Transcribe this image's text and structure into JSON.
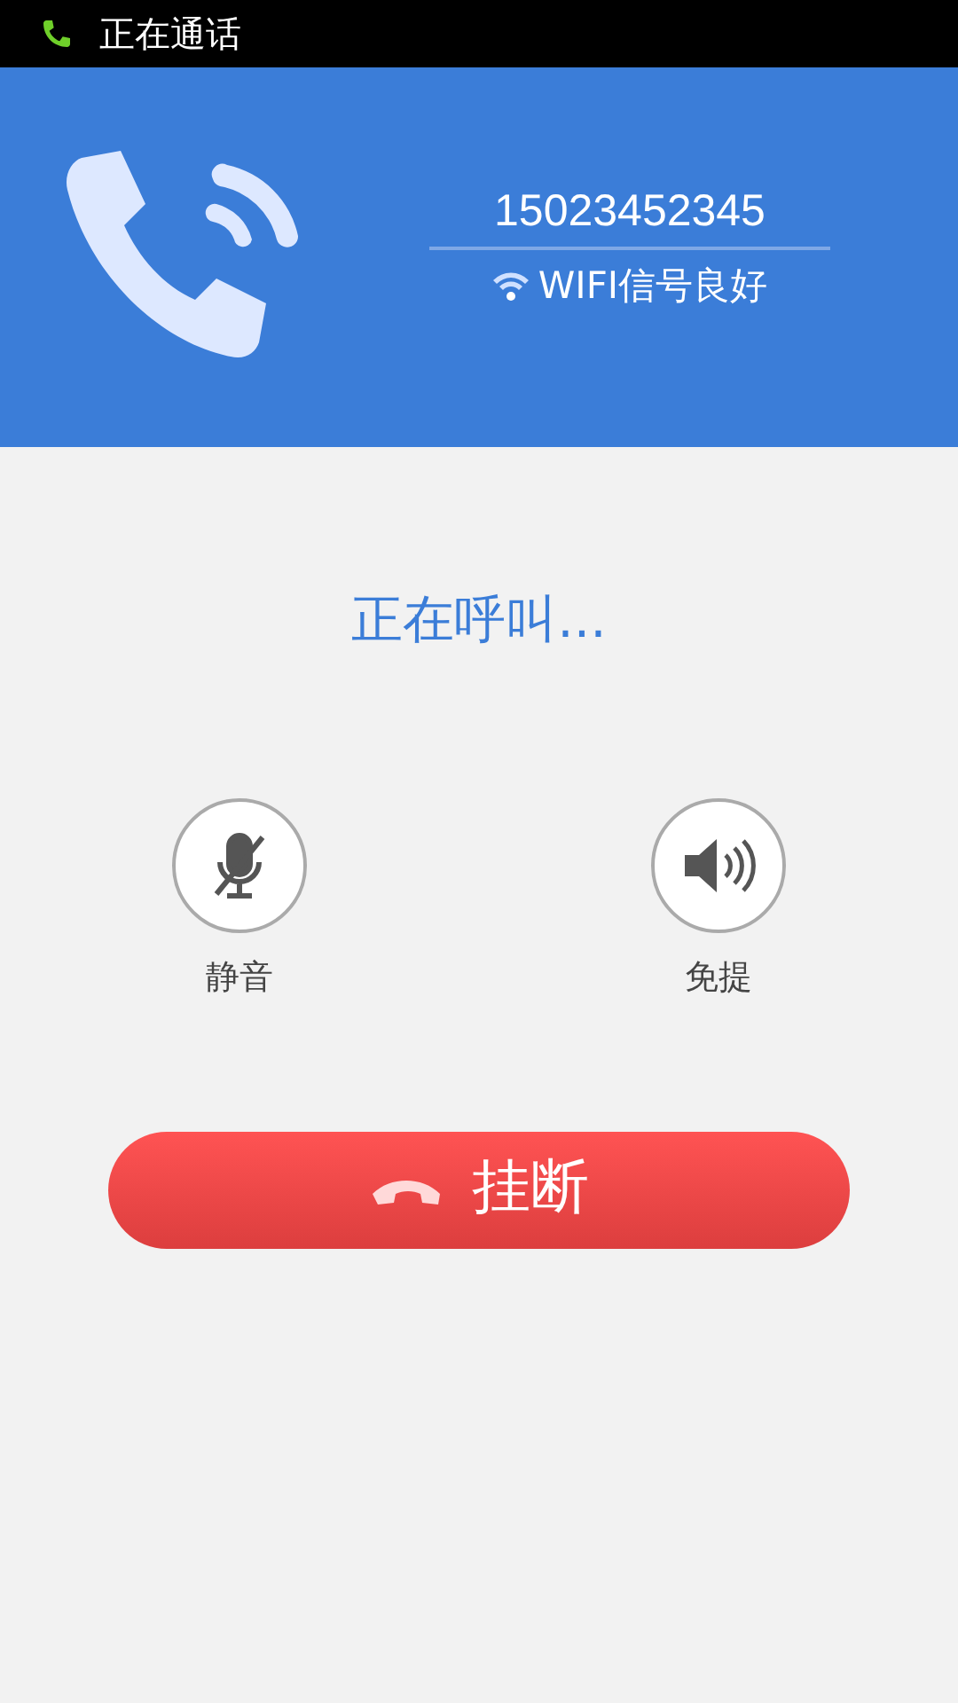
{
  "status_bar": {
    "title": "正在通话"
  },
  "header": {
    "number": "15023452345",
    "signal": "WIFI信号良好"
  },
  "call_status": "正在呼叫...",
  "controls": [
    {
      "kind": "mute",
      "label": "静音"
    },
    {
      "kind": "speaker",
      "label": "免提"
    }
  ],
  "hangup": {
    "label": "挂断"
  }
}
